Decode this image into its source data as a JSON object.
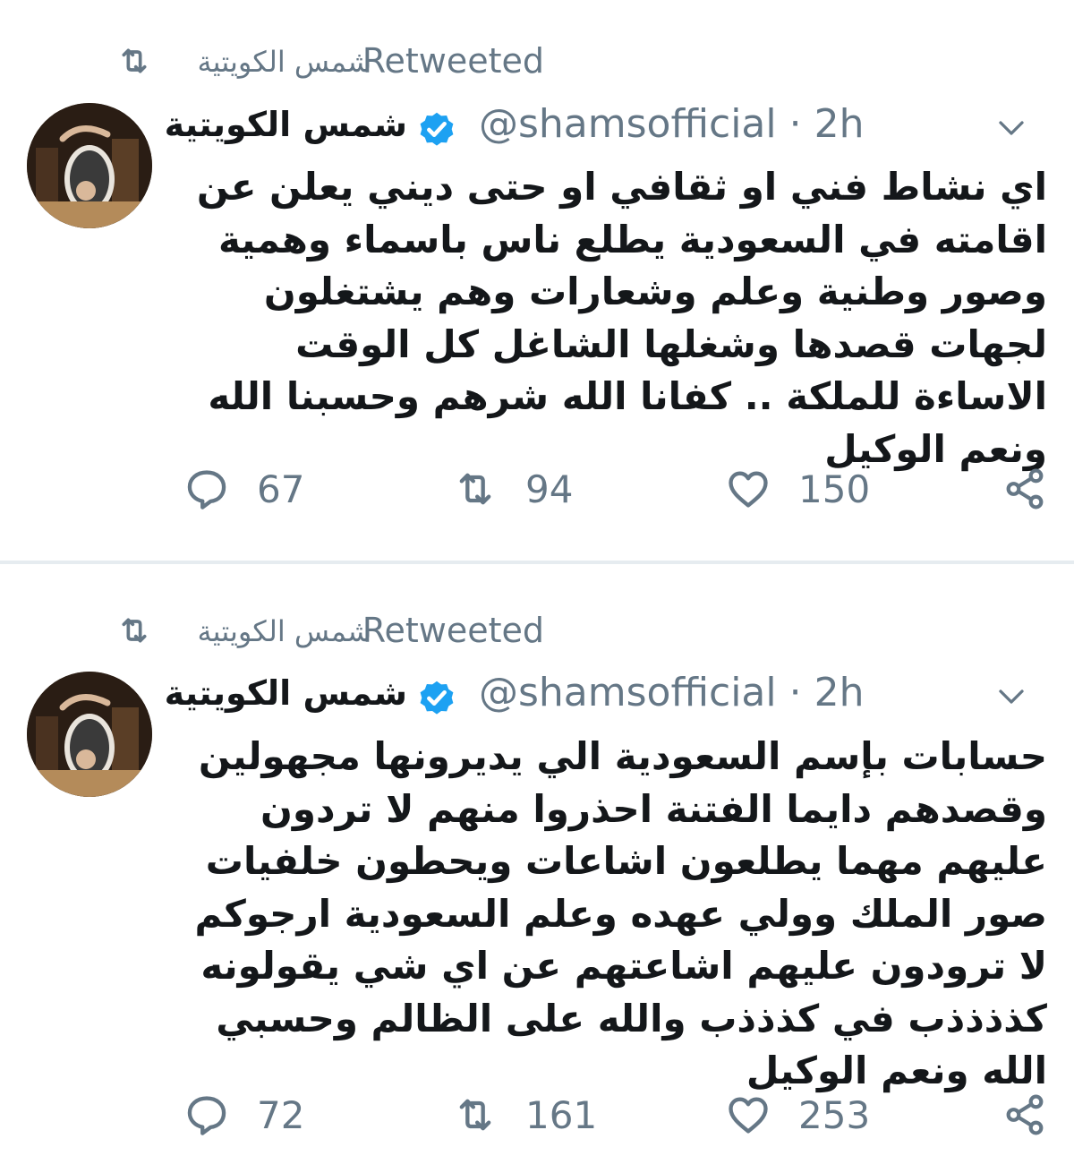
{
  "tweets": [
    {
      "retweet_label": "Retweeted",
      "retweeter_name": "شمس الكويتية",
      "display_name": "شمس الكويتية",
      "handle": "@shamsofficial",
      "separator": "·",
      "time": "2h",
      "text": "اي نشاط فني او ثقافي او حتى ديني يعلن عن اقامته في السعودية يطلع ناس باسماء وهمية وصور وطنية وعلم وشعارات وهم يشتغلون لجهات قصدها وشغلها الشاغل كل الوقت الاساءة للملكة .. كفانا الله شرهم وحسبنا الله ونعم الوكيل",
      "replies": "67",
      "retweets": "94",
      "likes": "150"
    },
    {
      "retweet_label": "Retweeted",
      "retweeter_name": "شمس الكويتية",
      "display_name": "شمس الكويتية",
      "handle": "@shamsofficial",
      "separator": "·",
      "time": "2h",
      "text": "حسابات بإسم السعودية الي يديرونها مجهولين وقصدهم دايما الفتنة احذروا منهم لا تردون عليهم مهما يطلعون اشاعات ويحطون خلفيات صور الملك وولي عهده وعلم السعودية ارجوكم لا ترودون عليهم اشاعتهم عن اي شي يقولونه كذذذذب في كذذذب والله على الظالم وحسبي الله ونعم الوكيل",
      "replies": "72",
      "retweets": "161",
      "likes": "253"
    }
  ],
  "colors": {
    "verified_blue": "#1da1f2",
    "muted_gray": "#657786",
    "text_dark": "#14171a",
    "divider": "#e6ecf0"
  },
  "icons": [
    "retweet-icon",
    "verified-badge-icon",
    "chevron-down-icon",
    "reply-icon",
    "heart-icon",
    "share-icon"
  ]
}
